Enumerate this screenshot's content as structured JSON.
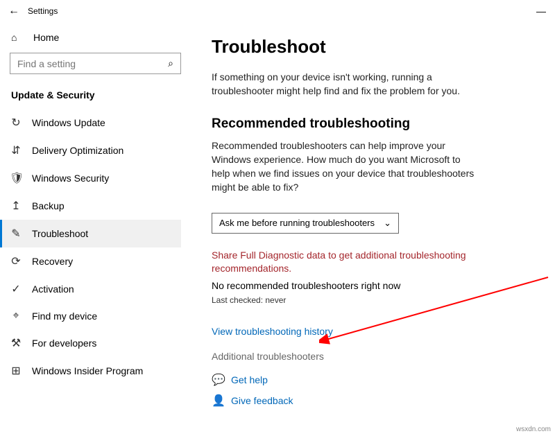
{
  "titlebar": {
    "title": "Settings"
  },
  "sidebar": {
    "home_label": "Home",
    "search_placeholder": "Find a setting",
    "category_label": "Update & Security",
    "items": [
      {
        "label": "Windows Update",
        "icon": "↻"
      },
      {
        "label": "Delivery Optimization",
        "icon": "⇵"
      },
      {
        "label": "Windows Security",
        "icon": "🛡"
      },
      {
        "label": "Backup",
        "icon": "↥"
      },
      {
        "label": "Troubleshoot",
        "icon": "✎"
      },
      {
        "label": "Recovery",
        "icon": "⟳"
      },
      {
        "label": "Activation",
        "icon": "✓"
      },
      {
        "label": "Find my device",
        "icon": "⌖"
      },
      {
        "label": "For developers",
        "icon": "⚒"
      },
      {
        "label": "Windows Insider Program",
        "icon": "⊞"
      }
    ]
  },
  "main": {
    "page_title": "Troubleshoot",
    "intro": "If something on your device isn't working, running a troubleshooter might help find and fix the problem for you.",
    "rec_heading": "Recommended troubleshooting",
    "rec_desc": "Recommended troubleshooters can help improve your Windows experience. How much do you want Microsoft to help when we find issues on your device that troubleshooters might be able to fix?",
    "dropdown_value": "Ask me before running troubleshooters",
    "warning": "Share Full Diagnostic data to get additional troubleshooting recommendations.",
    "no_recommend": "No recommended troubleshooters right now",
    "last_checked": "Last checked: never",
    "history_link": "View troubleshooting history",
    "additional_header": "Additional troubleshooters",
    "get_help": "Get help",
    "give_feedback": "Give feedback"
  },
  "watermark": "wsxdn.com"
}
